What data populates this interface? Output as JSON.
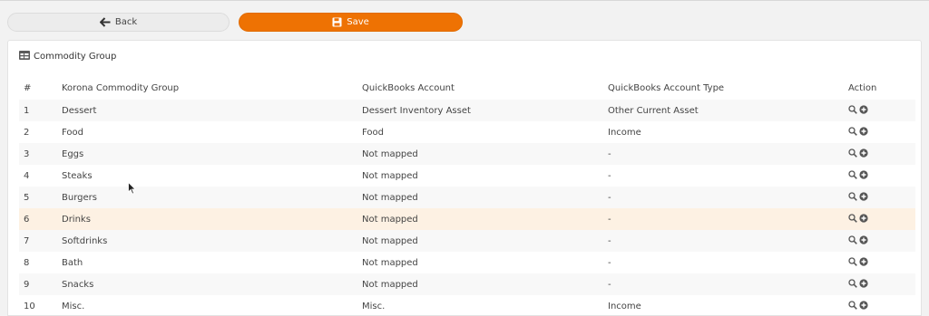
{
  "toolbar": {
    "back_label": "Back",
    "save_label": "Save"
  },
  "colors": {
    "accent": "#ee7203",
    "highlight_row": "#fdf1e3"
  },
  "panel": {
    "title": "Commodity Group",
    "title_icon": "table-icon"
  },
  "table": {
    "columns": [
      "#",
      "Korona Commodity Group",
      "QuickBooks Account",
      "QuickBooks Account Type",
      "Action"
    ],
    "rows": [
      {
        "n": "1",
        "group": "Dessert",
        "account": "Dessert Inventory Asset",
        "type": "Other Current Asset"
      },
      {
        "n": "2",
        "group": "Food",
        "account": "Food",
        "type": "Income"
      },
      {
        "n": "3",
        "group": "Eggs",
        "account": "Not mapped",
        "type": "-"
      },
      {
        "n": "4",
        "group": "Steaks",
        "account": "Not mapped",
        "type": "-"
      },
      {
        "n": "5",
        "group": "Burgers",
        "account": "Not mapped",
        "type": "-"
      },
      {
        "n": "6",
        "group": "Drinks",
        "account": "Not mapped",
        "type": "-",
        "highlighted": true
      },
      {
        "n": "7",
        "group": "Softdrinks",
        "account": "Not mapped",
        "type": "-"
      },
      {
        "n": "8",
        "group": "Bath",
        "account": "Not mapped",
        "type": "-"
      },
      {
        "n": "9",
        "group": "Snacks",
        "account": "Not mapped",
        "type": "-"
      },
      {
        "n": "10",
        "group": "Misc.",
        "account": "Misc.",
        "type": "Income"
      }
    ],
    "action_icons": [
      "search-icon",
      "plus-circle-icon"
    ]
  }
}
